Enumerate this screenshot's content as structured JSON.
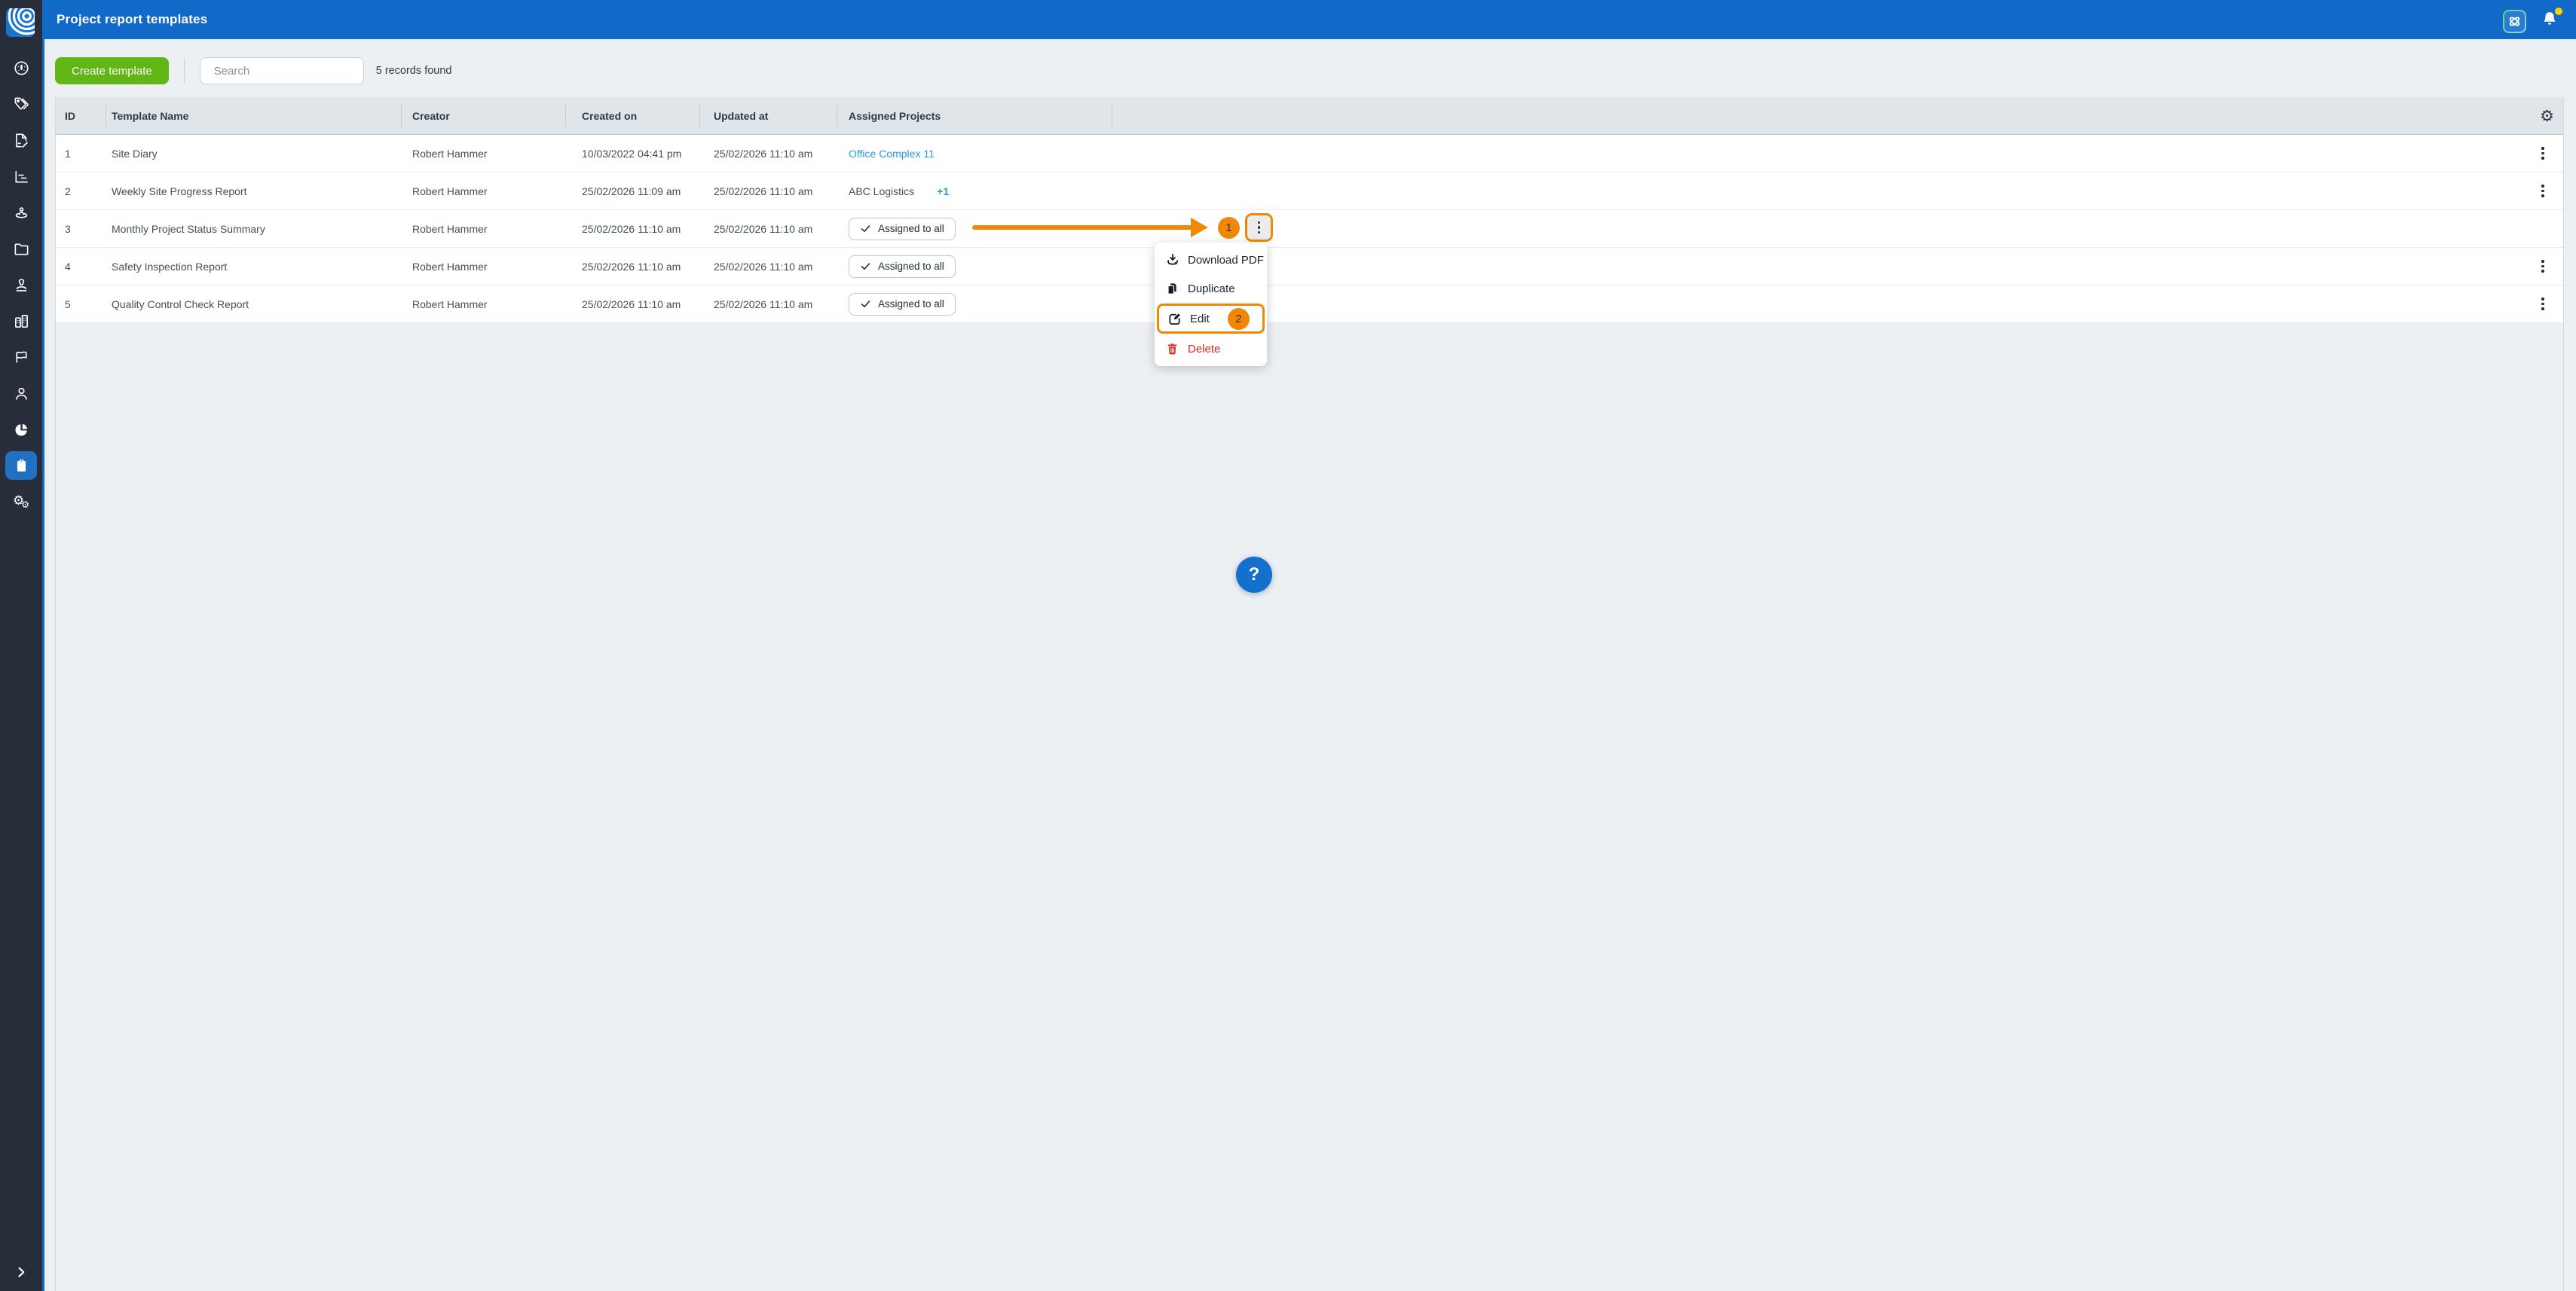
{
  "topbar": {
    "title": "Project report templates"
  },
  "sidebar": {
    "items": [
      "dashboard",
      "tags",
      "site-diary",
      "statistics",
      "site-staff",
      "documents",
      "approvals",
      "companies",
      "flags",
      "users",
      "analytics",
      "report-templates",
      "settings"
    ],
    "active": "report-templates"
  },
  "toolbar": {
    "create_label": "Create template",
    "search_placeholder": "Search",
    "records_text": "5 records found"
  },
  "table": {
    "headers": {
      "id": "ID",
      "name": "Template Name",
      "creator": "Creator",
      "created": "Created on",
      "updated": "Updated at",
      "assigned": "Assigned Projects"
    },
    "rows": [
      {
        "id": "1",
        "name": "Site Diary",
        "creator": "Robert Hammer",
        "created": "10/03/2022 04:41 pm",
        "updated": "25/02/2026 11:10 am",
        "assigned_link": "Office Complex 11"
      },
      {
        "id": "2",
        "name": "Weekly Site Progress Report",
        "creator": "Robert Hammer",
        "created": "25/02/2026 11:09 am",
        "updated": "25/02/2026 11:10 am",
        "assigned_text": "ABC Logistics",
        "assigned_more": "+1"
      },
      {
        "id": "3",
        "name": "Monthly Project Status Summary",
        "creator": "Robert Hammer",
        "created": "25/02/2026 11:10 am",
        "updated": "25/02/2026 11:10 am",
        "assigned_chip": "Assigned to all"
      },
      {
        "id": "4",
        "name": "Safety Inspection Report",
        "creator": "Robert Hammer",
        "created": "25/02/2026 11:10 am",
        "updated": "25/02/2026 11:10 am",
        "assigned_chip": "Assigned to all"
      },
      {
        "id": "5",
        "name": "Quality Control Check Report",
        "creator": "Robert Hammer",
        "created": "25/02/2026 11:10 am",
        "updated": "25/02/2026 11:10 am",
        "assigned_chip": "Assigned to all"
      }
    ]
  },
  "context_menu": {
    "items": [
      {
        "label": "Download PDF",
        "icon": "download-icon"
      },
      {
        "label": "Duplicate",
        "icon": "duplicate-icon"
      },
      {
        "label": "Edit",
        "icon": "edit-icon",
        "badge": "2",
        "highlighted": true
      },
      {
        "label": "Delete",
        "icon": "trash-icon",
        "danger": true
      }
    ]
  },
  "annotations": {
    "step_1": "1",
    "step_2": "2"
  },
  "help": {
    "label": "?"
  },
  "colors": {
    "primary_blue": "#1169c8",
    "sidebar_bg": "#272e3a",
    "create_green": "#61b615",
    "annotation_orange": "#f18805",
    "link_blue": "#2e95d8",
    "danger_red": "#e8261f",
    "notification_yellow": "#ffce00"
  }
}
